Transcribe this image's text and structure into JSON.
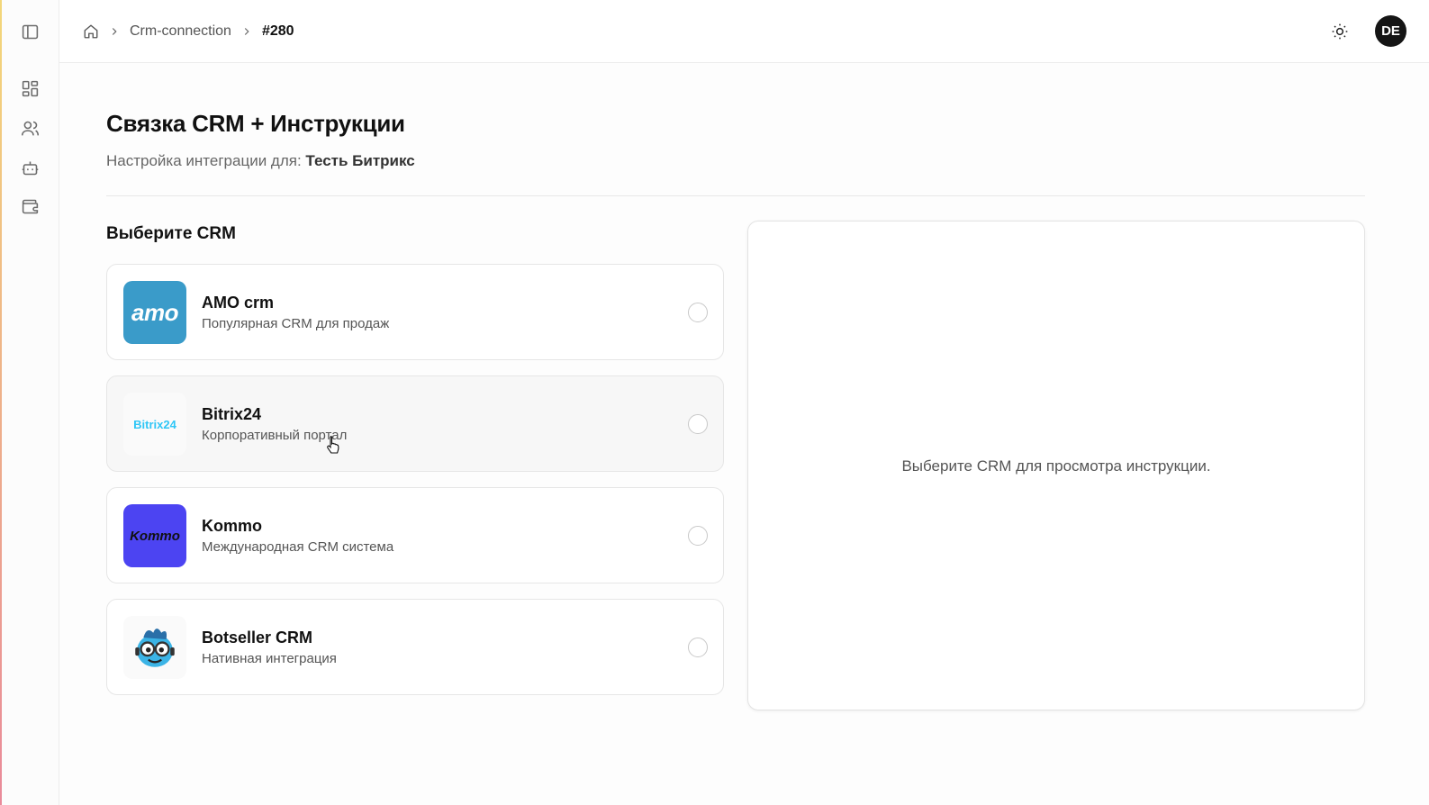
{
  "breadcrumb": {
    "home_icon": "home-icon",
    "items": [
      "Crm-connection",
      "#280"
    ]
  },
  "header": {
    "theme_icon": "sun-icon",
    "avatar_initials": "DE"
  },
  "sidebar": {
    "toggle_icon": "sidebar-toggle-icon",
    "items": [
      {
        "icon": "dashboard-icon"
      },
      {
        "icon": "users-icon"
      },
      {
        "icon": "bot-icon"
      },
      {
        "icon": "wallet-icon"
      }
    ]
  },
  "page": {
    "title": "Связка CRM + Инструкции",
    "subtitle_prefix": "Настройка интеграции для:",
    "subtitle_target": "Тесть Битрикс",
    "section_title": "Выберите CRM"
  },
  "crm_options": [
    {
      "name": "AMO crm",
      "description": "Популярная CRM для продаж",
      "logo_text": "amo",
      "color": "#3a9bc9",
      "selected": false
    },
    {
      "name": "Bitrix24",
      "description": "Корпоративный портал",
      "logo_text": "Bitrix24",
      "color": "#2fc6f6",
      "selected": false
    },
    {
      "name": "Kommo",
      "description": "Международная CRM система",
      "logo_text": "Kommo",
      "color": "#4c44f2",
      "selected": false
    },
    {
      "name": "Botseller CRM",
      "description": "Нативная интеграция",
      "logo_text": "",
      "color": "#3bb4e6",
      "selected": false
    }
  ],
  "preview": {
    "placeholder": "Выберите CRM для просмотра инструкции."
  }
}
